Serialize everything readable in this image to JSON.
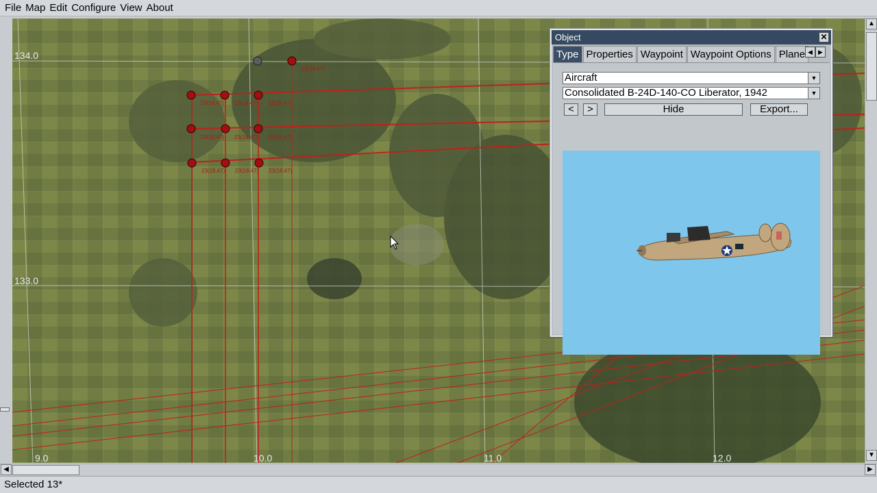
{
  "menu": [
    "File",
    "Map",
    "Edit",
    "Configure",
    "View",
    "About"
  ],
  "map": {
    "y_labels": [
      "134.0",
      "133.0"
    ],
    "x_labels": [
      "9.0",
      "10.0",
      "11.0",
      "12.0"
    ],
    "waypoint_labels": [
      "23(18.47)",
      "23(18.47)",
      "23(18.47)",
      "23(18.47)",
      "23(18.47)",
      "23(18.47)",
      "23(18.47)",
      "23(18.47)",
      "23(18.47)",
      "23(18.47)"
    ]
  },
  "dialog": {
    "title": "Object",
    "tabs": [
      "Type",
      "Properties",
      "Waypoint",
      "Waypoint Options",
      "Plane"
    ],
    "category": "Aircraft",
    "model": "Consolidated B-24D-140-CO Liberator, 1942",
    "prev_label": "<",
    "next_label": ">",
    "hide_label": "Hide",
    "export_label": "Export...",
    "preview_bg": "#7fc6ec"
  },
  "status": {
    "text": "Selected 13*"
  }
}
